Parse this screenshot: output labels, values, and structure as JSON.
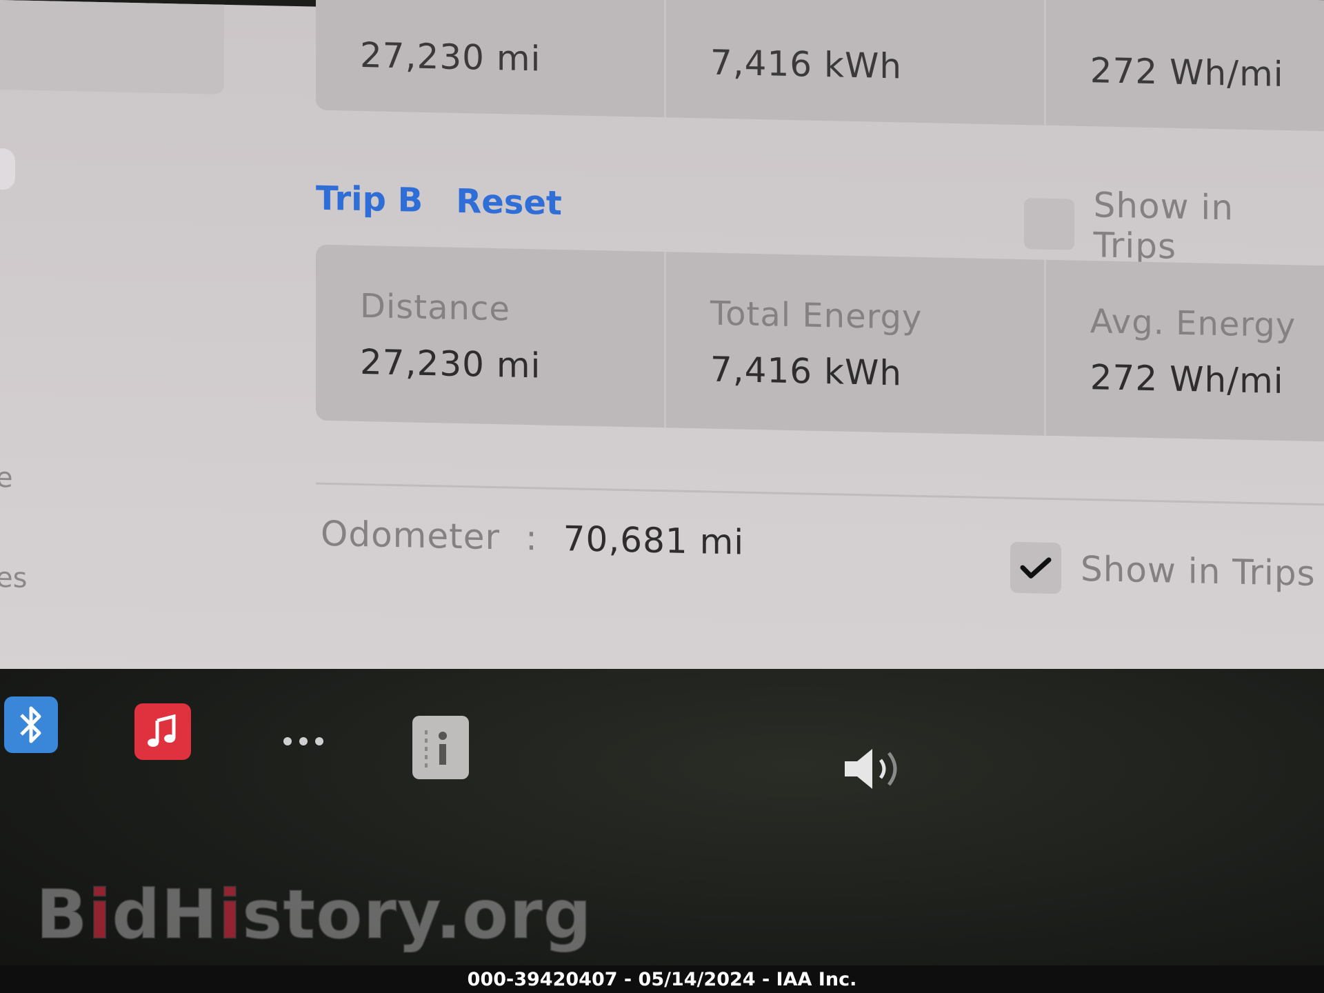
{
  "trip_a": {
    "distance_value": "27,230 mi",
    "total_energy_value": "7,416 kWh",
    "avg_energy_value": "272 Wh/mi"
  },
  "trip_b": {
    "title": "Trip B",
    "reset_label": "Reset",
    "show_in_trips_label": "Show in Trips",
    "show_in_trips_checked": false,
    "distance_label": "Distance",
    "distance_value": "27,230 mi",
    "total_energy_label": "Total Energy",
    "total_energy_value": "7,416 kWh",
    "avg_energy_label": "Avg. Energy",
    "avg_energy_value": "272 Wh/mi"
  },
  "odometer": {
    "label": "Odometer",
    "separator": ":",
    "value": "70,681 mi",
    "show_in_trips_label": "Show in Trips",
    "show_in_trips_checked": true
  },
  "sidebar_fragments": [
    "e",
    "es"
  ],
  "taskbar": {
    "icons": [
      "bluetooth-icon",
      "music-icon",
      "more-icon",
      "manual-info-icon",
      "volume-icon"
    ]
  },
  "watermark": {
    "part1": "B",
    "part2": "i",
    "part3": "dH",
    "part4": "i",
    "part5": "story.org"
  },
  "caption": "000-39420407 - 05/14/2024 - IAA Inc.",
  "colors": {
    "accent_blue": "#2f6ed7",
    "bluetooth_bg": "#3a86d8",
    "music_bg": "#e0323e"
  }
}
